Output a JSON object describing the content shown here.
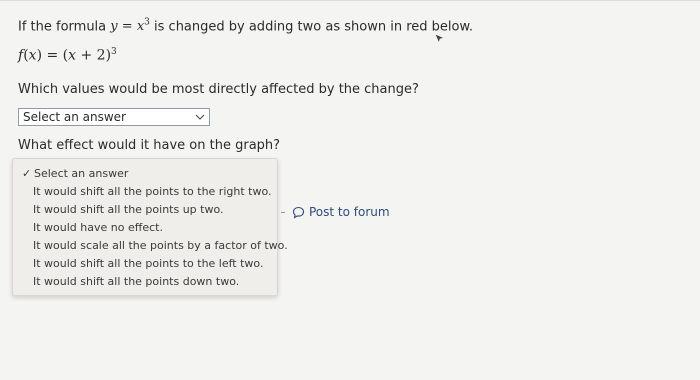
{
  "question": {
    "prefix": "If the formula ",
    "formula_y": "y",
    "formula_eq": " = ",
    "formula_x": "x",
    "formula_exp": "3",
    "suffix": " is changed by adding two as shown in red below."
  },
  "modified_formula": {
    "f": "f",
    "open": "(",
    "x": "x",
    "close": ")",
    "eq": " = (",
    "x2": "x",
    "plus": " + 2)",
    "exp": "3"
  },
  "prompt_1": "Which values would be most directly affected by the change?",
  "select_1": {
    "value": "Select an answer"
  },
  "prompt_2": "What effect would it have on the graph?",
  "dropdown_2": {
    "selected": "Select an answer",
    "check": "✓",
    "options": [
      "It would shift all the points to the right two.",
      "It would shift all the points up two.",
      "It would have no effect.",
      "It would scale all the points by a factor of two.",
      "It would shift all the points to the left two.",
      "It would shift all the points down two."
    ]
  },
  "post_to_forum": "Post to forum",
  "icons": {
    "chevron": "chevron-down-icon",
    "speech": "speech-bubble-icon",
    "cursor": "mouse-cursor-icon"
  }
}
